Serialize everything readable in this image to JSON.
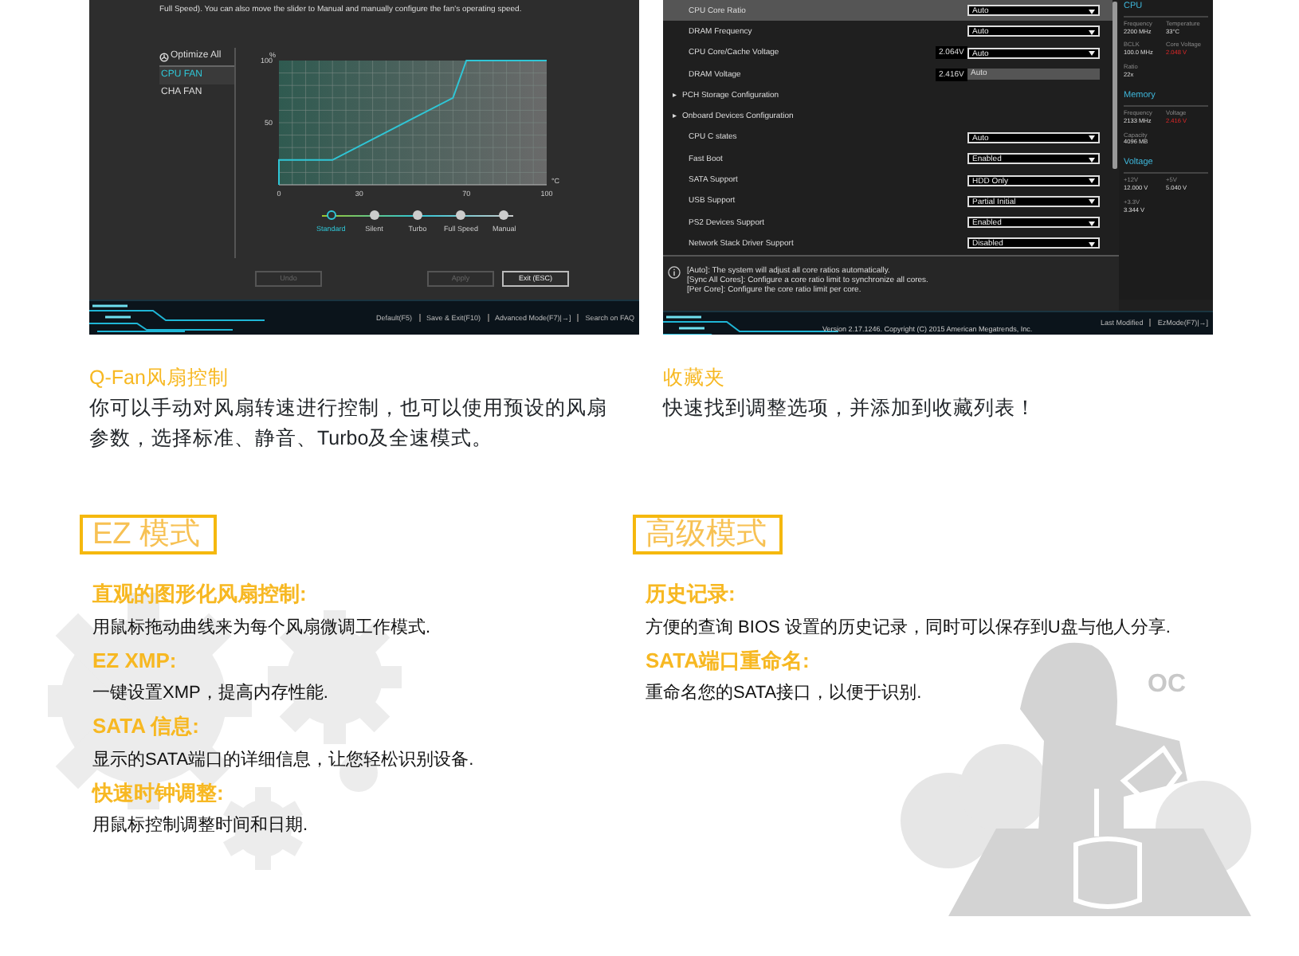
{
  "fan_window": {
    "description": "Full Speed). You can also move the slider to Manual and manually configure the fan's operating speed.",
    "optimize_label": "Optimize All",
    "fans": [
      {
        "label": "CPU FAN",
        "selected": true
      },
      {
        "label": "CHA FAN",
        "selected": false
      }
    ],
    "chart_data": {
      "type": "line",
      "xlabel": "°C",
      "ylabel": "%",
      "x": [
        0,
        0,
        20,
        65,
        70,
        100
      ],
      "series": [
        {
          "color": "#2fc6d6",
          "values": [
            0,
            20,
            20,
            70,
            100,
            100
          ]
        }
      ],
      "xlim": [
        0,
        100
      ],
      "ylim": [
        0,
        100
      ],
      "xticks": [
        0,
        30,
        70,
        100
      ],
      "yticks": [
        50,
        100
      ],
      "grid": true
    },
    "modes": [
      {
        "label": "Standard",
        "selected": true
      },
      {
        "label": "Silent",
        "selected": false
      },
      {
        "label": "Turbo",
        "selected": false
      },
      {
        "label": "Full Speed",
        "selected": false
      },
      {
        "label": "Manual",
        "selected": false
      }
    ],
    "buttons": [
      {
        "label": "Undo",
        "disabled": true
      },
      {
        "label": "Apply",
        "disabled": true
      },
      {
        "label": "Exit (ESC)",
        "disabled": false
      }
    ],
    "footer": [
      "Default(F5)",
      "Save & Exit(F10)",
      "Advanced Mode(F7)|→]",
      "Search on FAQ"
    ]
  },
  "bios_window": {
    "settings": [
      {
        "kind": "select",
        "label": "CPU Core Ratio",
        "value": "Auto",
        "selected": true
      },
      {
        "kind": "select",
        "label": "DRAM Frequency",
        "value": "Auto",
        "selected": false
      },
      {
        "kind": "select",
        "label": "CPU Core/Cache Voltage",
        "reading": "2.064V",
        "value": "Auto",
        "selected": false
      },
      {
        "kind": "field",
        "label": "DRAM Voltage",
        "reading": "2.416V",
        "value": "Auto",
        "selected": false
      },
      {
        "kind": "submenu",
        "marker": "▸",
        "label": "PCH Storage Configuration",
        "selected": false
      },
      {
        "kind": "submenu",
        "marker": "▸",
        "label": "Onboard Devices Configuration",
        "selected": false
      },
      {
        "kind": "select",
        "label": "CPU C states",
        "value": "Auto",
        "selected": false
      },
      {
        "kind": "select",
        "label": "Fast Boot",
        "value": "Enabled",
        "selected": false
      },
      {
        "kind": "select",
        "label": "SATA Support",
        "value": "HDD Only",
        "selected": false
      },
      {
        "kind": "select",
        "label": "USB Support",
        "value": "Partial Initial",
        "selected": false
      },
      {
        "kind": "select",
        "label": "PS2 Devices Support",
        "value": "Enabled",
        "selected": false
      },
      {
        "kind": "select",
        "label": "Network Stack Driver Support",
        "value": "Disabled",
        "selected": false
      }
    ],
    "help": [
      "[Auto]: The system will adjust all core ratios automatically.",
      "[Sync All Cores]: Configure a core ratio limit to synchronize all cores.",
      "[Per Core]: Configure the core ratio limit per core."
    ],
    "monitor": [
      {
        "title": "CPU",
        "readings": [
          {
            "label": "Frequency",
            "value": "2200 MHz",
            "alert": false
          },
          {
            "label": "Temperature",
            "value": "33°C",
            "alert": false
          },
          {
            "label": "BCLK",
            "value": "100.0 MHz",
            "alert": false
          },
          {
            "label": "Core Voltage",
            "value": "2.048 V",
            "alert": true
          },
          {
            "label": "Ratio",
            "value": "22x",
            "alert": false
          }
        ]
      },
      {
        "title": "Memory",
        "readings": [
          {
            "label": "Frequency",
            "value": "2133 MHz",
            "alert": false
          },
          {
            "label": "Voltage",
            "value": "2.416 V",
            "alert": true
          },
          {
            "label": "Capacity",
            "value": "4096 MB",
            "alert": false
          }
        ]
      },
      {
        "title": "Voltage",
        "readings": [
          {
            "label": "+12V",
            "value": "12.000 V",
            "alert": false
          },
          {
            "label": "+5V",
            "value": "5.040 V",
            "alert": false
          },
          {
            "label": "+3.3V",
            "value": "3.344 V",
            "alert": false
          }
        ]
      }
    ],
    "footer": [
      "Last Modified",
      "EzMode(F7)|→]"
    ],
    "version": "Version 2.17.1246. Copyright (C) 2015 American Megatrends, Inc."
  },
  "features": [
    {
      "title": "Q-Fan风扇控制",
      "text": "你可以手动对风扇转速进行控制，也可以使用预设的风扇参数，选择标准、静音、Turbo及全速模式。"
    },
    {
      "title": "收藏夹",
      "text": "快速找到调整选项，并添加到收藏列表！"
    }
  ],
  "sections": [
    {
      "title": "EZ 模式",
      "items": [
        {
          "heading": "直观的图形化风扇控制:",
          "text": "用鼠标拖动曲线来为每个风扇微调工作模式."
        },
        {
          "heading": "EZ XMP:",
          "text": "一键设置XMP，提高内存性能."
        },
        {
          "heading": "SATA 信息:",
          "text": "显示的SATA端口的详细信息，让您轻松识别设备."
        },
        {
          "heading": "快速时钟调整:",
          "text": "用鼠标控制调整时间和日期."
        }
      ]
    },
    {
      "title": "高级模式",
      "items": [
        {
          "heading": "历史记录:",
          "text": "方便的查询 BIOS 设置的历史记录，同时可以保存到U盘与他人分享."
        },
        {
          "heading": "SATA端口重命名:",
          "text": "重命名您的SATA接口，以便于识别."
        }
      ]
    }
  ],
  "illustration": {
    "label": "OC"
  }
}
